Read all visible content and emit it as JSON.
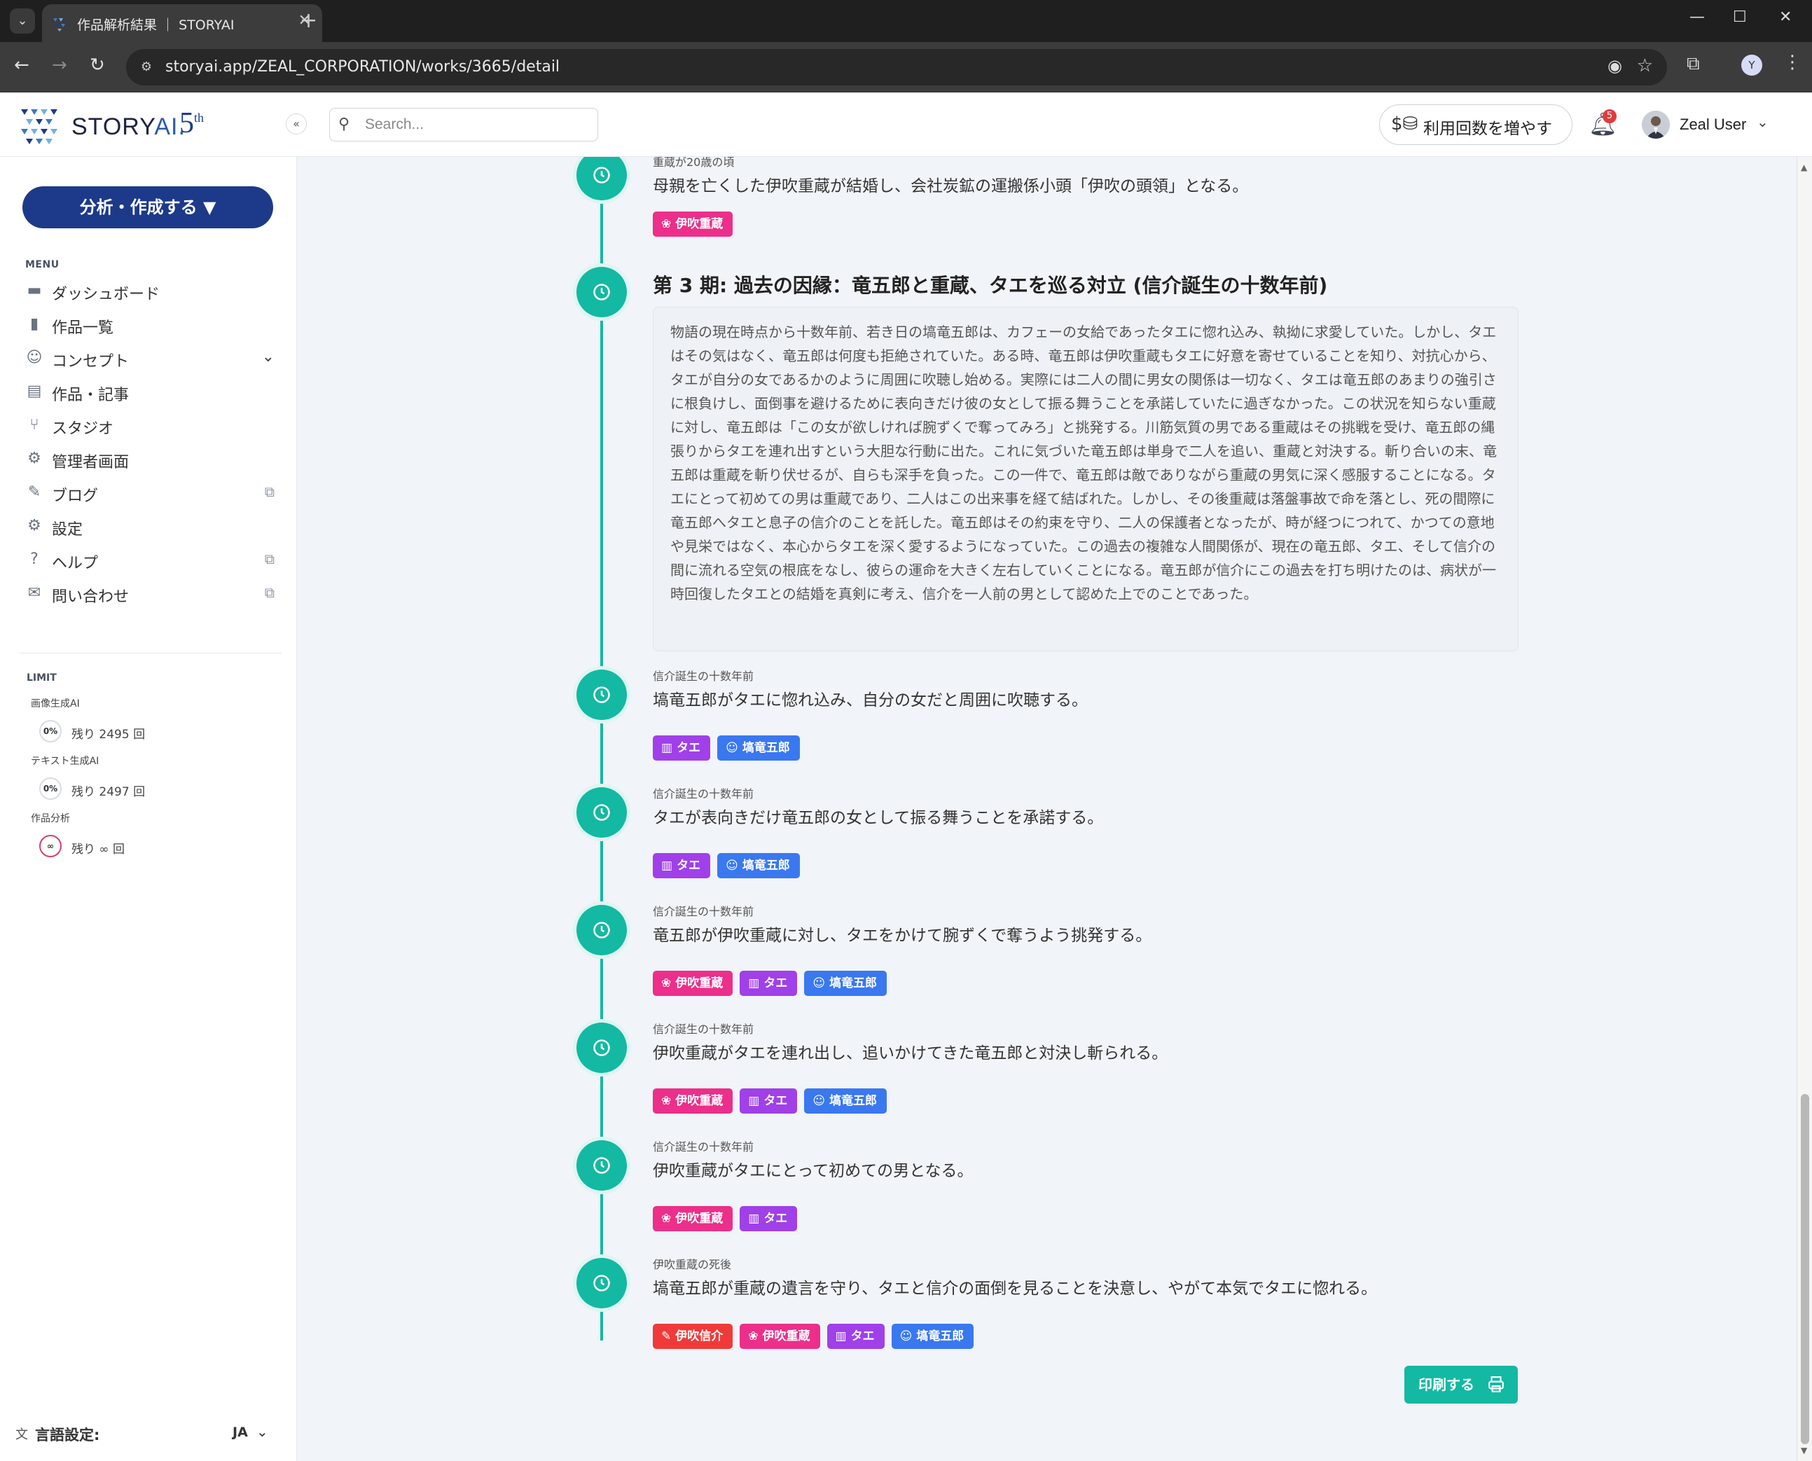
{
  "browser": {
    "tab_title": "作品解析結果 ｜ STORYAI",
    "url": "storyai.app/ZEAL_CORPORATION/works/3665/detail",
    "profile_initial": "Y"
  },
  "header": {
    "logo_text_a": "STORY",
    "logo_text_b": "AI.",
    "logo_fifth": "5",
    "logo_fifth_sup": "th",
    "collapse_symbol": "«",
    "search_placeholder": "Search...",
    "credits_label": "利用回数を増やす",
    "notification_count": "5",
    "user_name": "Zeal User"
  },
  "sidebar": {
    "primary_button": "分析・作成する ▼",
    "menu_heading": "MENU",
    "menu": [
      {
        "label": "ダッシュボード",
        "icon": "dashboard-icon"
      },
      {
        "label": "作品一覧",
        "icon": "document-icon"
      },
      {
        "label": "コンセプト",
        "icon": "smile-icon"
      },
      {
        "label": "作品・記事",
        "icon": "article-icon"
      },
      {
        "label": "スタジオ",
        "icon": "flow-icon"
      },
      {
        "label": "管理者画面",
        "icon": "gear-icon"
      },
      {
        "label": "ブログ",
        "icon": "edit-icon"
      },
      {
        "label": "設定",
        "icon": "gear-icon"
      },
      {
        "label": "ヘルプ",
        "icon": "help-icon"
      },
      {
        "label": "問い合わせ",
        "icon": "mail-icon"
      }
    ],
    "limit_heading": "LIMIT",
    "limits": [
      {
        "label": "画像生成AI",
        "percent": "0%",
        "remaining": "残り 2495 回"
      },
      {
        "label": "テキスト生成AI",
        "percent": "0%",
        "remaining": "残り 2497 回"
      },
      {
        "label": "作品分析",
        "percent": "∞",
        "remaining": "残り ∞ 回"
      }
    ],
    "language_label": "言語設定:",
    "language_value": "JA"
  },
  "timeline": {
    "first_event_label": "重蔵が20歳の頃",
    "first_event_title": "母親を亡くした伊吹重蔵が結婚し、会社炭鉱の運搬係小頭「伊吹の頭領」となる。",
    "phase_title": "第 3 期: 過去の因縁：竜五郎と重蔵、タエを巡る対立 (信介誕生の十数年前)",
    "phase_summary": "物語の現在時点から十数年前、若き日の塙竜五郎は、カフェーの女給であったタエに惚れ込み、執拗に求愛していた。しかし、タエはその気はなく、竜五郎は何度も拒絶されていた。ある時、竜五郎は伊吹重蔵もタエに好意を寄せていることを知り、対抗心から、タエが自分の女であるかのように周囲に吹聴し始める。実際には二人の間に男女の関係は一切なく、タエは竜五郎のあまりの強引さに根負けし、面倒事を避けるために表向きだけ彼の女として振る舞うことを承諾していたに過ぎなかった。この状況を知らない重蔵に対し、竜五郎は「この女が欲しければ腕ずくで奪ってみろ」と挑発する。川筋気質の男である重蔵はその挑戦を受け、竜五郎の縄張りからタエを連れ出すという大胆な行動に出た。これに気づいた竜五郎は単身で二人を追い、重蔵と対決する。斬り合いの末、竜五郎は重蔵を斬り伏せるが、自らも深手を負った。この一件で、竜五郎は敵でありながら重蔵の男気に深く感服することになる。タエにとって初めての男は重蔵であり、二人はこの出来事を経て結ばれた。しかし、その後重蔵は落盤事故で命を落とし、死の間際に竜五郎へタエと息子の信介のことを託した。竜五郎はその約束を守り、二人の保護者となったが、時が経つにつれて、かつての意地や見栄ではなく、本心からタエを深く愛するようになっていた。この過去の複雑な人間関係が、現在の竜五郎、タエ、そして信介の間に流れる空気の根底をなし、彼らの運命を大きく左右していくことになる。竜五郎が信介にこの過去を打ち明けたのは、病状が一時回復したタエとの結婚を真剣に考え、信介を一人前の男として認めた上でのことであった。",
    "events": [
      {
        "label": "信介誕生の十数年前",
        "title": "塙竜五郎がタエに惚れ込み、自分の女だと周囲に吹聴する。",
        "tags": [
          "タエ",
          "塙竜五郎"
        ]
      },
      {
        "label": "信介誕生の十数年前",
        "title": "タエが表向きだけ竜五郎の女として振る舞うことを承諾する。",
        "tags": [
          "タエ",
          "塙竜五郎"
        ]
      },
      {
        "label": "信介誕生の十数年前",
        "title": "竜五郎が伊吹重蔵に対し、タエをかけて腕ずくで奪うよう挑発する。",
        "tags": [
          "伊吹重蔵",
          "タエ",
          "塙竜五郎"
        ]
      },
      {
        "label": "信介誕生の十数年前",
        "title": "伊吹重蔵がタエを連れ出し、追いかけてきた竜五郎と対決し斬られる。",
        "tags": [
          "伊吹重蔵",
          "タエ",
          "塙竜五郎"
        ]
      },
      {
        "label": "信介誕生の十数年前",
        "title": "伊吹重蔵がタエにとって初めての男となる。",
        "tags": [
          "伊吹重蔵",
          "タエ"
        ]
      },
      {
        "label": "伊吹重蔵の死後",
        "title": "塙竜五郎が重蔵の遺言を守り、タエと信介の面倒を見ることを決意し、やがて本気でタエに惚れる。",
        "tags": [
          "伊吹信介",
          "伊吹重蔵",
          "タエ",
          "塙竜五郎"
        ]
      }
    ],
    "tag_names": {
      "shinsuke": "伊吹信介",
      "juzo": "伊吹重蔵",
      "tae": "タエ",
      "ryugoro": "塙竜五郎"
    },
    "tag_colors": {
      "shinsuke": "#f03a3a",
      "juzo": "#ec2f8a",
      "tae": "#a040e8",
      "ryugoro": "#3a78f0"
    },
    "print_label": "印刷する"
  },
  "colors": {
    "accent": "#13b9a2",
    "primary": "#1d3a8a"
  }
}
